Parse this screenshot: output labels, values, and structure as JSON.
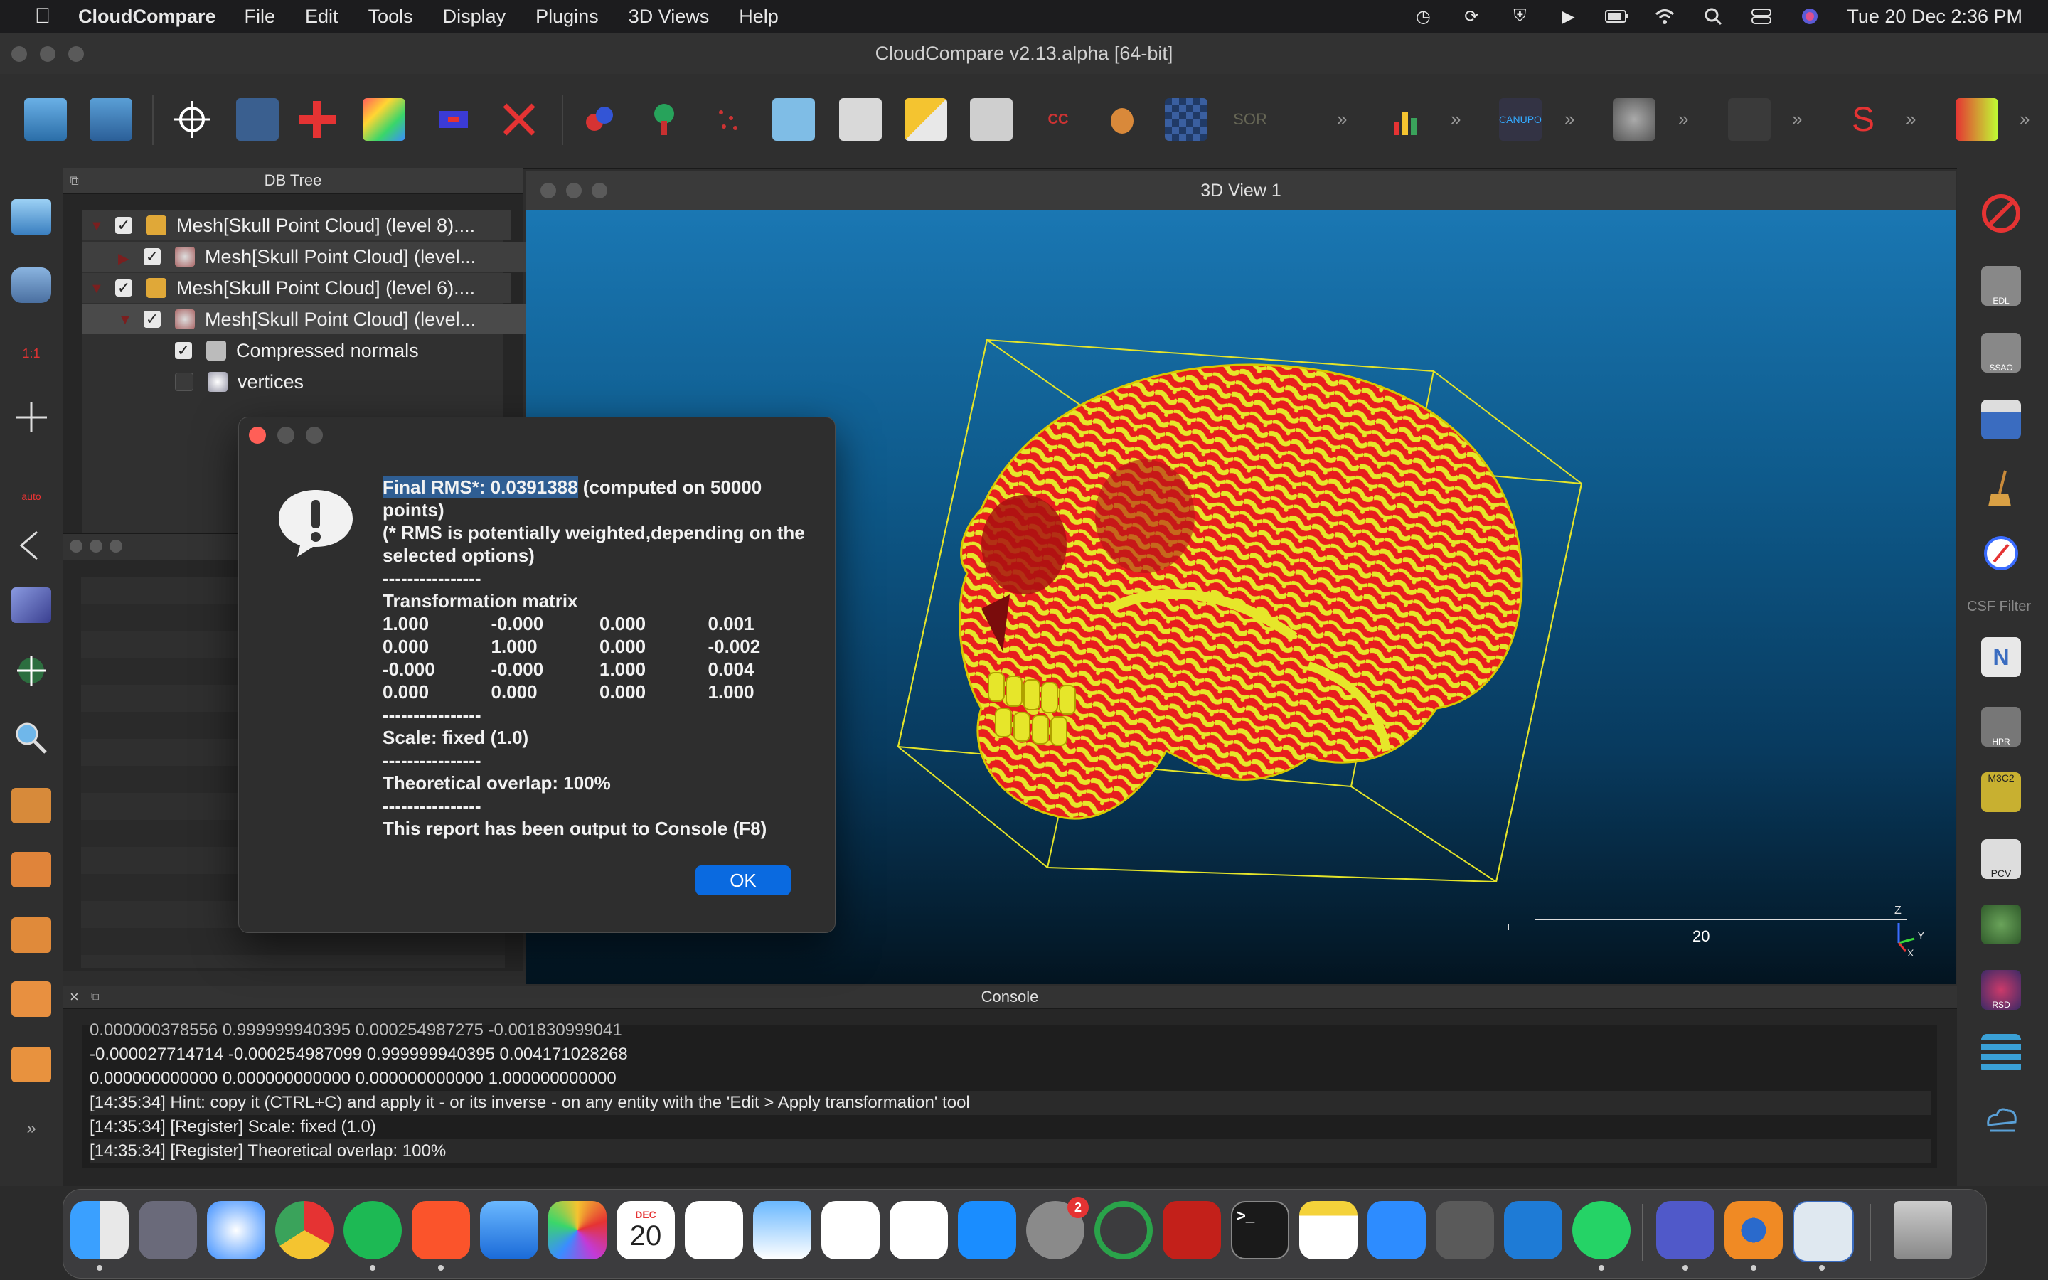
{
  "menubar": {
    "app_name": "CloudCompare",
    "menus": [
      "File",
      "Edit",
      "Tools",
      "Display",
      "Plugins",
      "3D Views",
      "Help"
    ],
    "datetime": "Tue 20 Dec  2:36 PM"
  },
  "window": {
    "title": "CloudCompare v2.13.alpha [64-bit]"
  },
  "db_tree": {
    "title": "DB Tree",
    "rows": [
      {
        "label": "Mesh[Skull Point Cloud] (level 8)....",
        "checked": true
      },
      {
        "label": "Mesh[Skull Point Cloud] (level...",
        "checked": true
      },
      {
        "label": "Mesh[Skull Point Cloud] (level 6)....",
        "checked": true
      },
      {
        "label": "Mesh[Skull Point Cloud] (level...",
        "checked": true
      },
      {
        "label": "Compressed normals",
        "checked": true
      },
      {
        "label": "vertices",
        "checked": false
      }
    ]
  },
  "view3d": {
    "title": "3D View 1",
    "scale_label": "20",
    "axis_z": "Z",
    "axis_y": "Y",
    "axis_x": "X"
  },
  "right_toolbar": {
    "csf_label": "CSF Filter"
  },
  "dialog": {
    "rms_line": "Final RMS*: 0.0391388",
    "rms_suffix": " (computed on 50000 points)",
    "note": "(* RMS is potentially weighted,depending on the selected options)",
    "sep": "----------------",
    "matrix_title": "Transformation matrix",
    "matrix": [
      [
        "1.000",
        "-0.000",
        "0.000",
        "0.001"
      ],
      [
        "0.000",
        "1.000",
        "0.000",
        "-0.002"
      ],
      [
        "-0.000",
        "-0.000",
        "1.000",
        "0.004"
      ],
      [
        "0.000",
        "0.000",
        "0.000",
        "1.000"
      ]
    ],
    "scale": "Scale: fixed (1.0)",
    "overlap": "Theoretical overlap: 100%",
    "report": "This report has been output to Console (F8)",
    "ok_label": "OK"
  },
  "console": {
    "title": "Console",
    "lines": [
      "0.000000378556 0.999999940395 0.000254987275 -0.001830999041",
      "-0.000027714714 -0.000254987099 0.999999940395 0.004171028268",
      "0.000000000000 0.000000000000 0.000000000000 1.000000000000",
      "[14:35:34] Hint: copy it (CTRL+C) and apply it - or its inverse - on any entity with the 'Edit > Apply transformation' tool",
      "[14:35:34] [Register] Scale: fixed (1.0)",
      "[14:35:34] [Register] Theoretical overlap: 100%"
    ]
  },
  "dock": {
    "calendar_month": "DEC",
    "calendar_day": "20",
    "settings_badge": "2"
  }
}
